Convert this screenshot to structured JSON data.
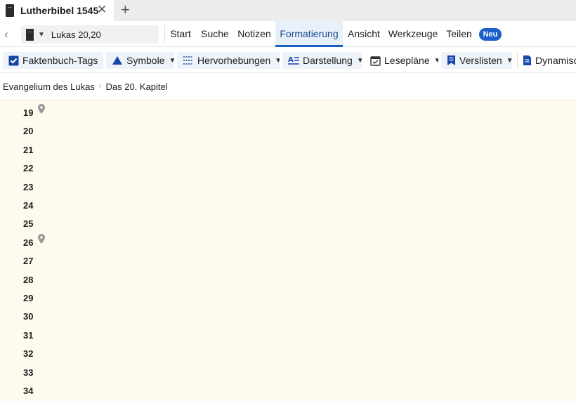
{
  "tab": {
    "title": "Lutherbibel 1545",
    "close": "✕",
    "add": "+",
    "icon": "book-icon"
  },
  "nav": {
    "back": "‹",
    "reference": "Lukas 20,20",
    "menu": [
      "Start",
      "Suche",
      "Notizen",
      "Formatierung",
      "Ansicht",
      "Werkzeuge",
      "Teilen"
    ],
    "active_menu": "Formatierung",
    "badge": "Neu"
  },
  "toolbar": {
    "items": [
      {
        "label": "Faktenbuch-Tags",
        "icon": "checkbox-icon"
      },
      {
        "label": "Symbole",
        "icon": "triangle-icon"
      },
      {
        "label": "Hervorhebungen",
        "icon": "highlight-icon"
      },
      {
        "label": "Darstellung",
        "icon": "text-format-icon"
      },
      {
        "label": "Lesepläne",
        "icon": "calendar-icon"
      },
      {
        "label": "Verslisten",
        "icon": "bookmark-list-icon"
      },
      {
        "label": "Dynamisc",
        "icon": "document-icon"
      }
    ]
  },
  "breadcrumb": [
    "Evangelium des Lukas",
    "Das 20. Kapitel"
  ],
  "verses": [
    "19",
    "20",
    "21",
    "22",
    "23",
    "24",
    "25",
    "26",
    "27",
    "28",
    "29",
    "30",
    "31",
    "32",
    "33",
    "34"
  ],
  "pinned_verses": [
    "19",
    "26"
  ],
  "colors": {
    "accent": "#1860c4",
    "badge": "#1b5fc9",
    "reader_bg": "#fffaee",
    "tool_bg": "#eef3fa",
    "icon_blue": "#1747a6"
  }
}
